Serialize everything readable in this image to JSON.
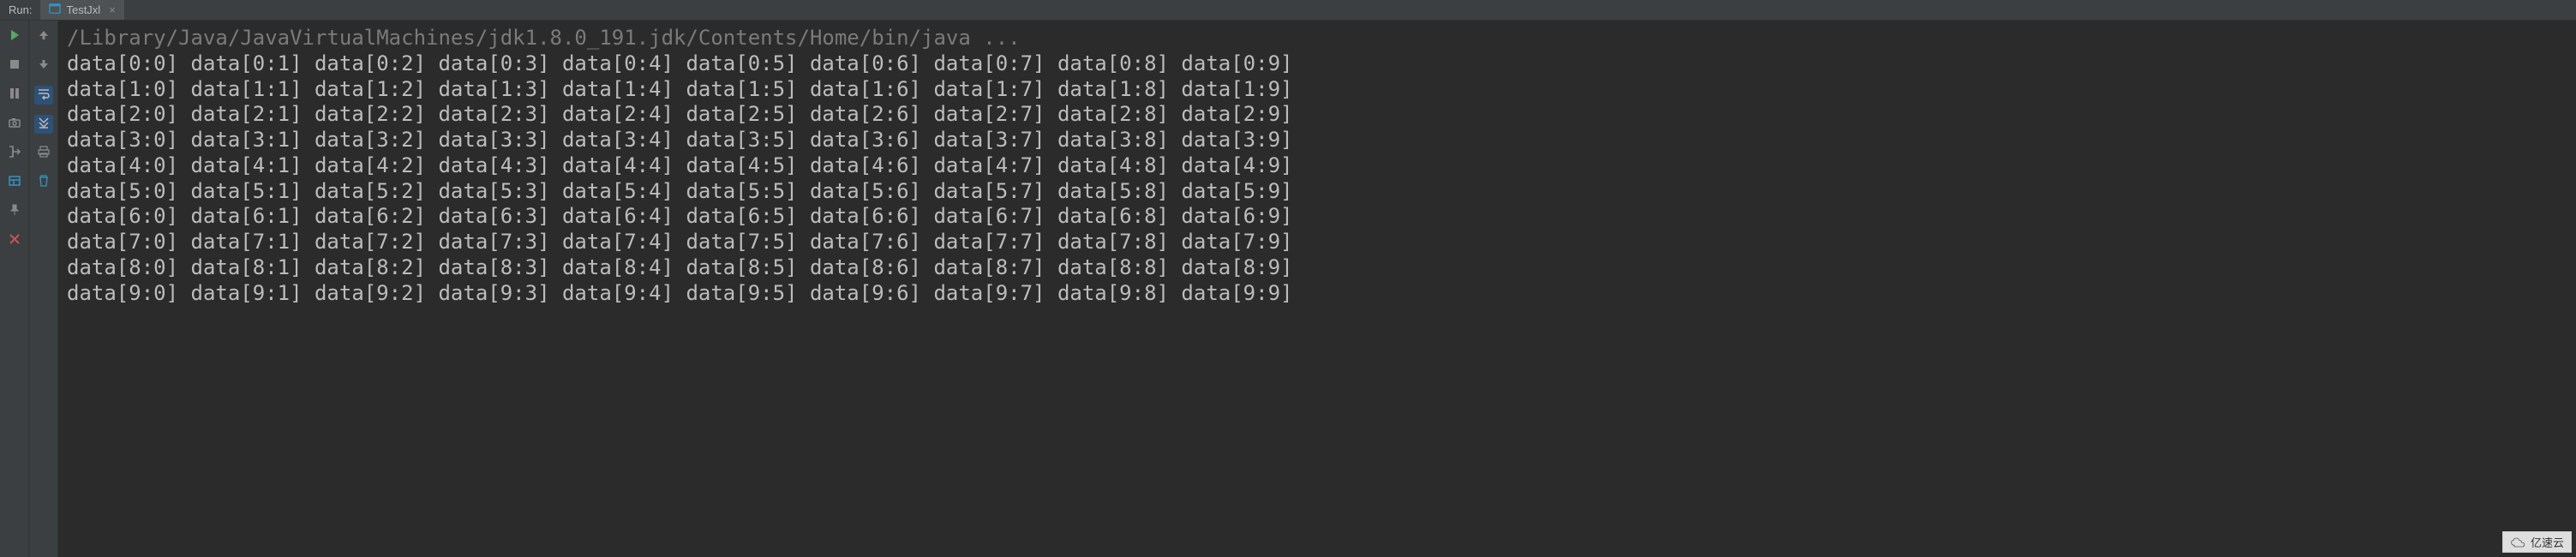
{
  "header": {
    "run_label": "Run:",
    "tab_label": "TestJxl"
  },
  "toolbar_left": [
    {
      "name": "rerun-button",
      "icon": "play-green",
      "interact": true
    },
    {
      "name": "stop-button",
      "icon": "stop",
      "interact": true
    },
    {
      "name": "pause-button",
      "icon": "pause",
      "interact": true
    },
    {
      "name": "dump-threads-button",
      "icon": "camera",
      "interact": true
    },
    {
      "name": "exit-button",
      "icon": "exit",
      "interact": true
    },
    {
      "name": "layout-button",
      "icon": "layout",
      "interact": true
    },
    {
      "name": "pin-button",
      "icon": "pin",
      "interact": true
    },
    {
      "name": "close-button",
      "icon": "close-red",
      "interact": true
    }
  ],
  "toolbar_right": [
    {
      "name": "up-button",
      "icon": "up",
      "interact": true
    },
    {
      "name": "down-button",
      "icon": "down",
      "interact": true
    },
    {
      "name": "soft-wrap-button",
      "icon": "wrap",
      "interact": true,
      "active": true
    },
    {
      "name": "scroll-end-button",
      "icon": "scroll-end",
      "interact": true,
      "active": true
    },
    {
      "name": "print-button",
      "icon": "print",
      "interact": true
    },
    {
      "name": "clear-all-button",
      "icon": "trash",
      "interact": true
    }
  ],
  "console": {
    "command": "/Library/Java/JavaVirtualMachines/jdk1.8.0_191.jdk/Contents/Home/bin/java ...",
    "rows": 10,
    "cols": 10,
    "cell_template": "data[{r}:{c}]"
  },
  "watermark": "亿速云"
}
